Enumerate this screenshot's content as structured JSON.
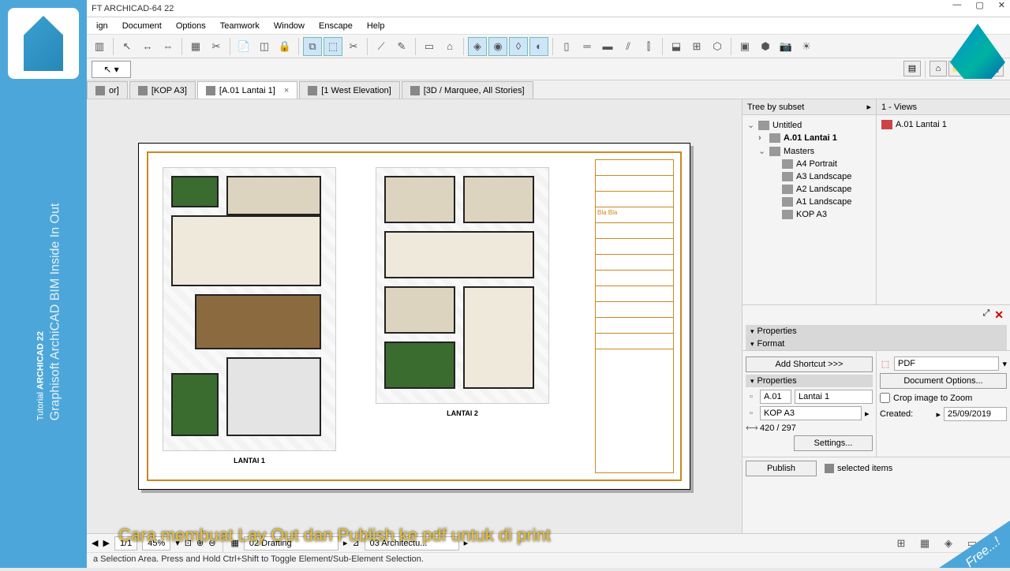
{
  "banner": {
    "line1_a": "Tutorial ",
    "line1_b": "ARCHICAD 22",
    "line2": "Graphisoft ArchiCAD BIM Inside In Out",
    "free": "Free...!"
  },
  "title": "FT ARCHICAD-64 22",
  "menu": [
    "ign",
    "Document",
    "Options",
    "Teamwork",
    "Window",
    "Enscape",
    "Help"
  ],
  "tabs": [
    {
      "label": "or]"
    },
    {
      "label": "[KOP A3]"
    },
    {
      "label": "[A.01 Lantai 1]",
      "active": true,
      "closable": true
    },
    {
      "label": "[1 West Elevation]"
    },
    {
      "label": "[3D / Marquee, All Stories]"
    }
  ],
  "navigator": {
    "headL": "Tree by subset",
    "headR": "1 - Views",
    "tree": [
      {
        "label": "Untitled",
        "chev": "⌄",
        "bold": false,
        "indent": 0
      },
      {
        "label": "A.01 Lantai 1",
        "chev": "›",
        "bold": true,
        "indent": 1
      },
      {
        "label": "Masters",
        "chev": "⌄",
        "bold": false,
        "indent": 1
      },
      {
        "label": "A4 Portrait",
        "chev": "",
        "indent": 2
      },
      {
        "label": "A3 Landscape",
        "chev": "",
        "indent": 2
      },
      {
        "label": "A2 Landscape",
        "chev": "",
        "indent": 2
      },
      {
        "label": "A1 Landscape",
        "chev": "",
        "indent": 2
      },
      {
        "label": "KOP A3",
        "chev": "",
        "indent": 2
      }
    ],
    "views_item": "A.01 Lantai 1"
  },
  "props": {
    "shortcut_btn": "Add Shortcut >>>",
    "head1": "Properties",
    "head2": "Format",
    "head3": "Properties",
    "id": "A.01",
    "name": "Lantai 1",
    "master": "KOP A3",
    "size": "420 / 297",
    "settings_btn": "Settings...",
    "format_val": "PDF",
    "doc_opts_btn": "Document Options...",
    "crop_label": "Crop image to Zoom",
    "created_label": "Created:",
    "created_val": "25/09/2019",
    "publish_btn": "Publish",
    "selected_label": "selected items"
  },
  "sheet": {
    "plan1_label": "LANTAI 1",
    "plan2_label": "LANTAI 2",
    "note": "Bla Bla"
  },
  "status": {
    "page": "1/1",
    "zoom": "45%",
    "draft": "02 Drafting",
    "arch": "03 Architectu..."
  },
  "hint": "a Selection Area. Press and Hold Ctrl+Shift to Toggle Element/Sub-Element Selection.",
  "caption": "Cara membuat Lay Out dan Publish ke pdf untuk di print"
}
